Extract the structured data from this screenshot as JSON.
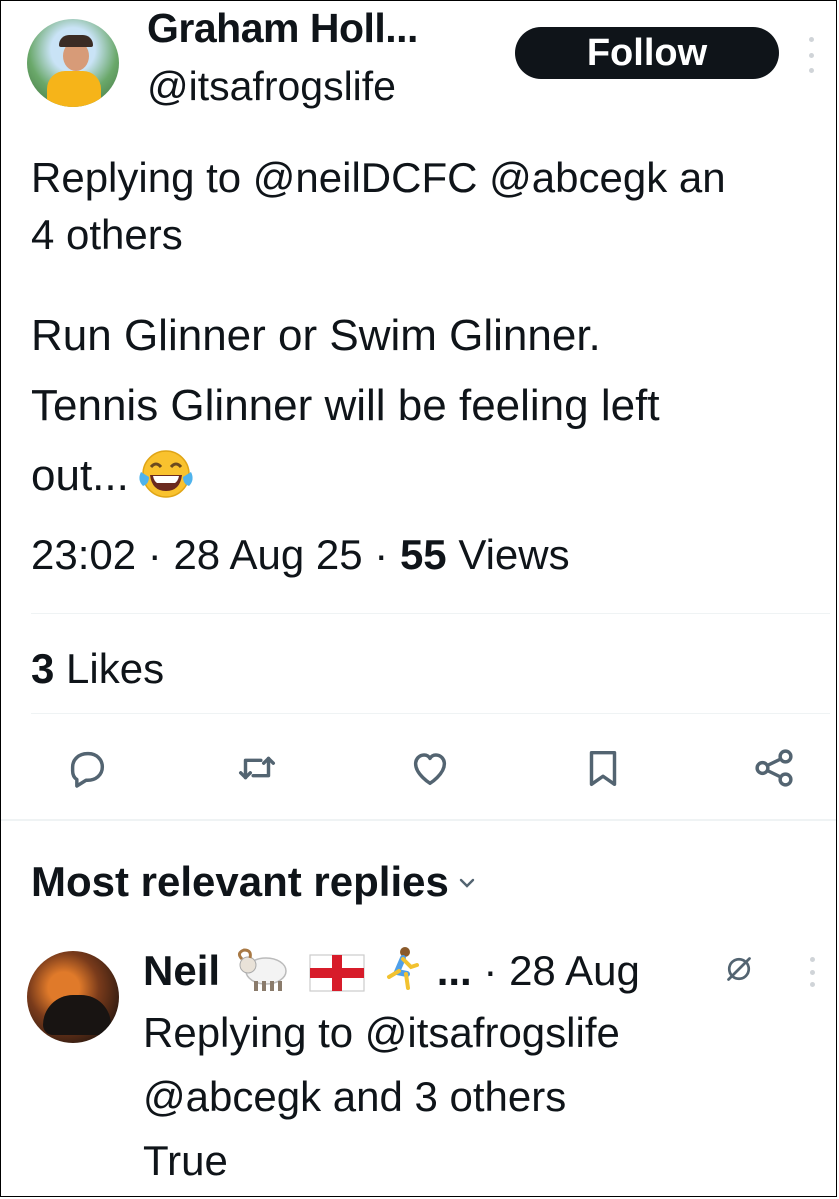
{
  "author": {
    "display_name": "Graham Holl...",
    "handle": "@itsafrogslife",
    "follow_label": "Follow"
  },
  "tweet": {
    "replying_prefix": "Replying to",
    "replying_mentions": "@neilDCFC @abcegk an",
    "replying_more": "4 others",
    "text_line1": "Run Glinner or Swim Glinner.",
    "text_line2": "Tennis Glinner will be feeling left",
    "text_line3": "out...",
    "emoji": "face-with-tears-of-joy",
    "time": "23:02",
    "date": "28 Aug 25",
    "views_count": "55",
    "views_label": "Views",
    "likes_count": "3",
    "likes_label": "Likes"
  },
  "actions": [
    {
      "name": "reply-icon"
    },
    {
      "name": "retweet-icon"
    },
    {
      "name": "like-icon"
    },
    {
      "name": "bookmark-icon"
    },
    {
      "name": "share-icon"
    }
  ],
  "replies_section": {
    "title": "Most relevant replies"
  },
  "reply": {
    "display_name": "Neil",
    "name_emojis": [
      "ram",
      "england-flag",
      "runner"
    ],
    "ellipsis": "...",
    "date": "28 Aug",
    "replying_line1": "Replying to @itsafrogslife",
    "replying_line2": "@abcegk and 3 others",
    "text": "True"
  },
  "colors": {
    "text": "#0f1419",
    "button_bg": "#0f1419",
    "button_text": "#ffffff",
    "divider": "#eff3f4",
    "icon": "#536471",
    "emoji_yellow": "#f9c22e"
  }
}
